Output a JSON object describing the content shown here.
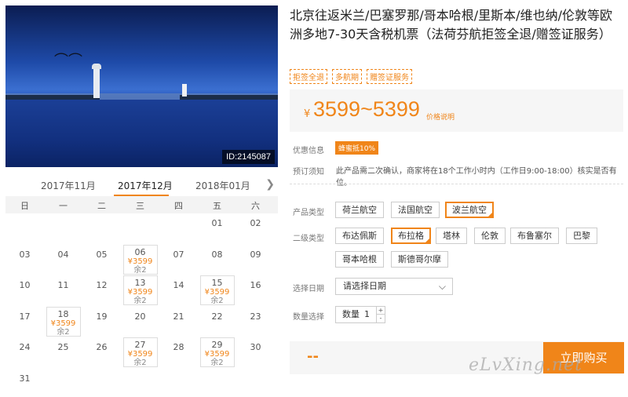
{
  "photo": {
    "id_label": "ID:2145087"
  },
  "calendar": {
    "months": [
      "2017年11月",
      "2017年12月",
      "2018年01月"
    ],
    "next_icon": "chevron-right-icon",
    "weekdays": [
      "日",
      "一",
      "二",
      "三",
      "四",
      "五",
      "六"
    ],
    "days": [
      {
        "d": "01",
        "col": 5,
        "row": 0
      },
      {
        "d": "02",
        "col": 6,
        "row": 0
      },
      {
        "d": "03",
        "col": 0,
        "row": 1
      },
      {
        "d": "04",
        "col": 1,
        "row": 1
      },
      {
        "d": "05",
        "col": 2,
        "row": 1
      },
      {
        "d": "06",
        "col": 3,
        "row": 1,
        "price": "¥3599",
        "left": "余2"
      },
      {
        "d": "07",
        "col": 4,
        "row": 1
      },
      {
        "d": "08",
        "col": 5,
        "row": 1
      },
      {
        "d": "09",
        "col": 6,
        "row": 1
      },
      {
        "d": "10",
        "col": 0,
        "row": 2
      },
      {
        "d": "11",
        "col": 1,
        "row": 2
      },
      {
        "d": "12",
        "col": 2,
        "row": 2
      },
      {
        "d": "13",
        "col": 3,
        "row": 2,
        "price": "¥3599",
        "left": "余2"
      },
      {
        "d": "14",
        "col": 4,
        "row": 2
      },
      {
        "d": "15",
        "col": 5,
        "row": 2,
        "price": "¥3599",
        "left": "余2"
      },
      {
        "d": "16",
        "col": 6,
        "row": 2
      },
      {
        "d": "17",
        "col": 0,
        "row": 3
      },
      {
        "d": "18",
        "col": 1,
        "row": 3,
        "price": "¥3599",
        "left": "余2"
      },
      {
        "d": "19",
        "col": 2,
        "row": 3
      },
      {
        "d": "20",
        "col": 3,
        "row": 3
      },
      {
        "d": "21",
        "col": 4,
        "row": 3
      },
      {
        "d": "22",
        "col": 5,
        "row": 3
      },
      {
        "d": "23",
        "col": 6,
        "row": 3
      },
      {
        "d": "24",
        "col": 0,
        "row": 4
      },
      {
        "d": "25",
        "col": 1,
        "row": 4
      },
      {
        "d": "26",
        "col": 2,
        "row": 4
      },
      {
        "d": "27",
        "col": 3,
        "row": 4,
        "price": "¥3599",
        "left": "余2"
      },
      {
        "d": "28",
        "col": 4,
        "row": 4
      },
      {
        "d": "29",
        "col": 5,
        "row": 4,
        "price": "¥3599",
        "left": "余2"
      },
      {
        "d": "30",
        "col": 6,
        "row": 4
      },
      {
        "d": "31",
        "col": 0,
        "row": 5
      }
    ]
  },
  "product": {
    "title": "北京往返米兰/巴塞罗那/哥本哈根/里斯本/维也纳/伦敦等欧洲多地7-30天含税机票（法荷芬航拒签全退/赠签证服务）",
    "tags": [
      "拒签全退",
      "多航期",
      "赠签证服务"
    ],
    "price": {
      "currency": "¥",
      "range": "3599~5399",
      "explain": "价格说明"
    },
    "promo": {
      "label": "优惠信息",
      "badge": "蜂蜜抵10%"
    },
    "notice": {
      "label": "预订须知",
      "text": "此产品需二次确认，商家将在18个工作小时内（工作日9:00-18:00）核实是否有位。"
    },
    "product_type": {
      "label": "产品类型",
      "options": [
        "荷兰航空",
        "法国航空",
        "波兰航空"
      ],
      "selected": 2
    },
    "sub_type": {
      "label": "二级类型",
      "options": [
        "布达佩斯",
        "布拉格",
        "塔林",
        "伦敦",
        "布鲁塞尔",
        "巴黎",
        "哥本哈根",
        "斯德哥尔摩"
      ],
      "selected": 1
    },
    "date": {
      "label": "选择日期",
      "placeholder": "请选择日期"
    },
    "quantity": {
      "label": "数量选择",
      "field_label": "数量",
      "value": "1",
      "up": "+",
      "down": "-"
    },
    "total": "--",
    "buy_label": "立即购买"
  },
  "watermark": "eLvXing.net",
  "colors": {
    "accent": "#f08519",
    "band_bg": "#f6f6f6"
  }
}
